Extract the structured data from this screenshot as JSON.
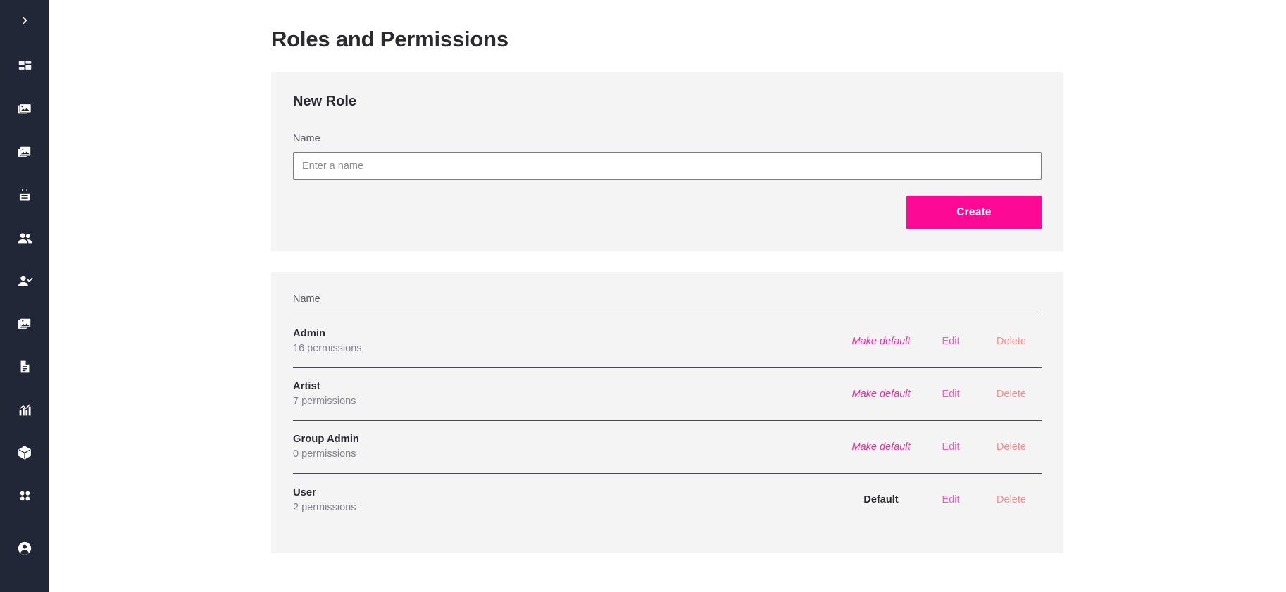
{
  "colors": {
    "sidebar_bg": "#222738",
    "card_bg": "#f4f4f4",
    "accent_pink": "#fc0a95",
    "link_pink": "#f22d9a",
    "edit_pink": "#f85bb3",
    "delete_pink": "#fb8a8a",
    "text_dark": "#2b2b2f",
    "text_muted": "#83838b"
  },
  "sidebar": {
    "toggle": {
      "icon": "chevron-right-icon"
    },
    "items": [
      {
        "icon": "dashboard-grid-icon"
      },
      {
        "icon": "folder-image-icon"
      },
      {
        "icon": "image-stack-icon"
      },
      {
        "icon": "calendar-icon"
      },
      {
        "icon": "people-icon"
      },
      {
        "icon": "person-check-icon"
      },
      {
        "icon": "image-stack-icon"
      },
      {
        "icon": "document-icon"
      },
      {
        "icon": "bar-chart-icon"
      },
      {
        "icon": "box-cube-icon"
      },
      {
        "icon": "four-dots-grid-icon"
      }
    ],
    "account": {
      "icon": "account-circle-icon"
    }
  },
  "page": {
    "title": "Roles and Permissions"
  },
  "new_role": {
    "title": "New Role",
    "name_label": "Name",
    "name_value": "",
    "name_placeholder": "Enter a name",
    "create_label": "Create"
  },
  "roles_table": {
    "header_name": "Name",
    "rows": [
      {
        "name": "Admin",
        "permissions": "16 permissions",
        "default_label": "Make default",
        "is_default": false,
        "edit_label": "Edit",
        "delete_label": "Delete"
      },
      {
        "name": "Artist",
        "permissions": "7 permissions",
        "default_label": "Make default",
        "is_default": false,
        "edit_label": "Edit",
        "delete_label": "Delete"
      },
      {
        "name": "Group Admin",
        "permissions": "0 permissions",
        "default_label": "Make default",
        "is_default": false,
        "edit_label": "Edit",
        "delete_label": "Delete"
      },
      {
        "name": "User",
        "permissions": "2 permissions",
        "default_label": "Default",
        "is_default": true,
        "edit_label": "Edit",
        "delete_label": "Delete"
      }
    ]
  }
}
